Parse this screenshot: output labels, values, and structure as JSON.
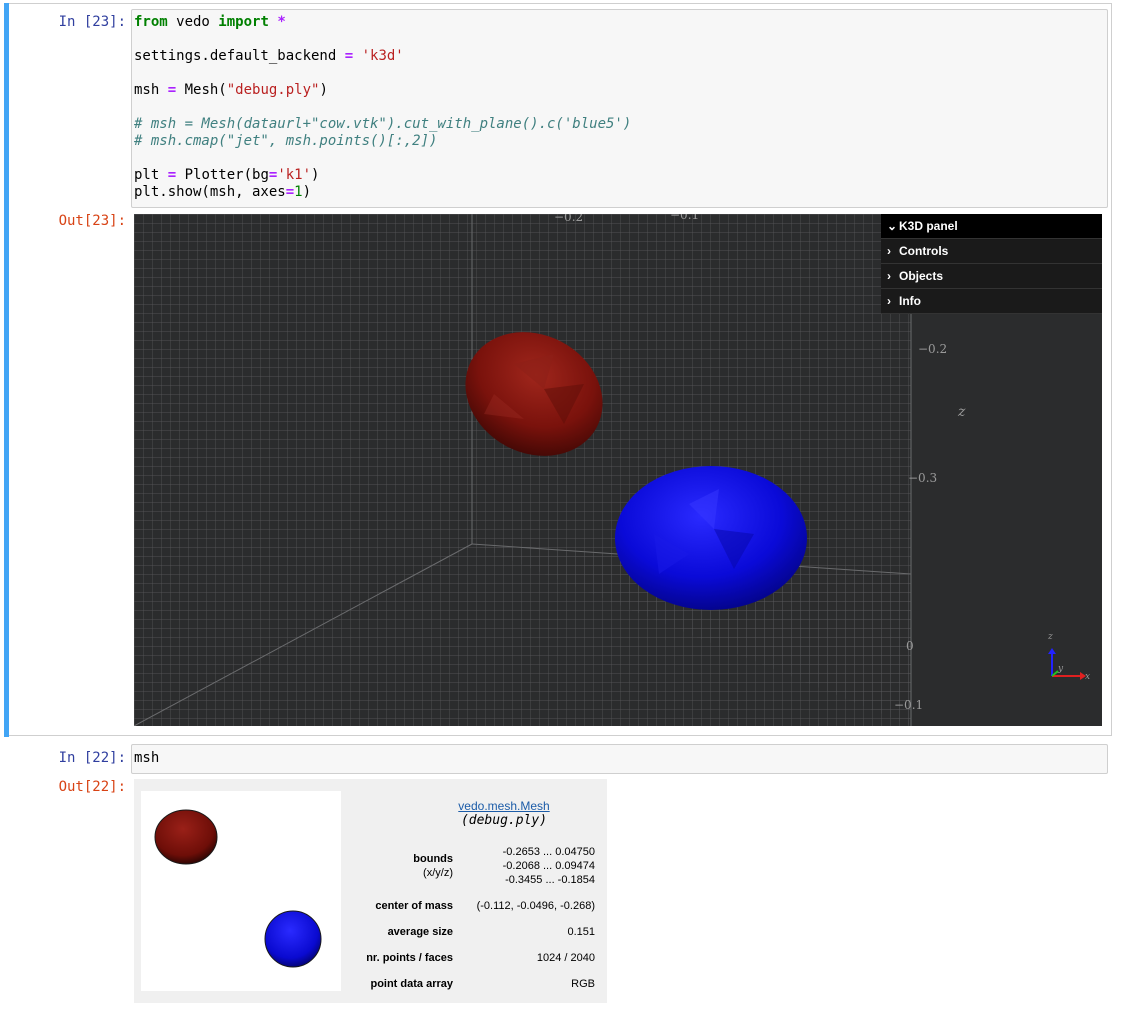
{
  "cell1": {
    "in_prompt": "In [23]:",
    "out_prompt": "Out[23]:",
    "code_lines": [
      {
        "parts": [
          {
            "t": "from",
            "c": "k"
          },
          {
            "t": " vedo ",
            "c": ""
          },
          {
            "t": "import",
            "c": "k"
          },
          {
            "t": " ",
            "c": ""
          },
          {
            "t": "*",
            "c": "o"
          }
        ]
      },
      {
        "parts": []
      },
      {
        "parts": [
          {
            "t": "settings.default_backend ",
            "c": ""
          },
          {
            "t": "=",
            "c": "o"
          },
          {
            "t": " ",
            "c": ""
          },
          {
            "t": "'k3d'",
            "c": "s"
          }
        ]
      },
      {
        "parts": []
      },
      {
        "parts": [
          {
            "t": "msh ",
            "c": ""
          },
          {
            "t": "=",
            "c": "o"
          },
          {
            "t": " Mesh(",
            "c": ""
          },
          {
            "t": "\"debug.ply\"",
            "c": "s"
          },
          {
            "t": ")",
            "c": ""
          }
        ]
      },
      {
        "parts": []
      },
      {
        "parts": [
          {
            "t": "# msh = Mesh(dataurl+\"cow.vtk\").cut_with_plane().c('blue5')",
            "c": "c"
          }
        ]
      },
      {
        "parts": [
          {
            "t": "# msh.cmap(\"jet\", msh.points()[:,2])",
            "c": "c"
          }
        ]
      },
      {
        "parts": []
      },
      {
        "parts": [
          {
            "t": "plt ",
            "c": ""
          },
          {
            "t": "=",
            "c": "o"
          },
          {
            "t": " Plotter(bg",
            "c": ""
          },
          {
            "t": "=",
            "c": "o"
          },
          {
            "t": "'k1'",
            "c": "s"
          },
          {
            "t": ")",
            "c": ""
          }
        ]
      },
      {
        "parts": [
          {
            "t": "plt.show(msh, axes",
            "c": ""
          },
          {
            "t": "=",
            "c": "o"
          },
          {
            "t": "1",
            "c": "m"
          },
          {
            "t": ")",
            "c": ""
          }
        ]
      }
    ]
  },
  "k3d": {
    "panel_title": "K3D panel",
    "items": [
      "Controls",
      "Objects",
      "Info"
    ],
    "axis_labels": {
      "top_a": "−0.2",
      "top_b": "−0.1",
      "right_1": "−0.2",
      "right_z": "z",
      "right_2": "−0.3",
      "right_3": "0",
      "right_4": "−0.1",
      "gizmo_z": "z",
      "gizmo_y": "y",
      "gizmo_x": "x"
    },
    "colors": {
      "red_mesh": "#7a120c",
      "blue_mesh": "#0a0ad8",
      "background": "#2b2c2d"
    }
  },
  "cell2": {
    "in_prompt": "In [22]:",
    "out_prompt": "Out[22]:",
    "code": "msh"
  },
  "summary": {
    "title": "vedo.mesh.Mesh",
    "subtitle": "(debug.ply)",
    "bounds_label": "bounds",
    "bounds_sublabel": "(x/y/z)",
    "bounds_values": [
      "-0.2653 ... 0.04750",
      "-0.2068 ... 0.09474",
      "-0.3455 ... -0.1854"
    ],
    "center_label": "center of mass",
    "center_value": "(-0.112, -0.0496, -0.268)",
    "avg_label": "average size",
    "avg_value": "0.151",
    "points_label": "nr. points / faces",
    "points_value": "1024 / 2040",
    "pda_label": "point data array",
    "pda_value": "RGB"
  }
}
